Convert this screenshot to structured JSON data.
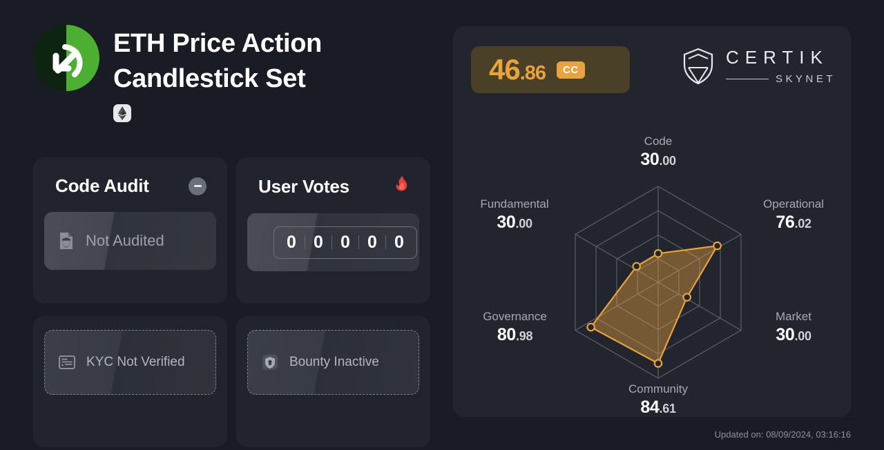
{
  "project": {
    "title": "ETH Price Action Candlestick Set",
    "logo_icon": "arrow-up-right-circle-logo",
    "chain_badges": [
      {
        "name": "ethereum-chain-badge",
        "icon": "ethereum-icon"
      }
    ]
  },
  "cards": {
    "code_audit": {
      "title": "Code Audit",
      "status_icon": "minus-badge-icon",
      "pill": {
        "label": "Not Audited",
        "icon": "document-shield-icon"
      }
    },
    "user_votes": {
      "title": "User Votes",
      "status_icon": "flame-icon",
      "counter_digits": [
        "0",
        "0",
        "0",
        "0",
        "0"
      ]
    },
    "kyc": {
      "pill": {
        "label": "KYC Not Verified",
        "icon": "id-card-icon"
      }
    },
    "bounty": {
      "pill": {
        "label": "Bounty Inactive",
        "icon": "shield-lock-icon"
      }
    }
  },
  "score": {
    "integer": "46",
    "decimal": ".86",
    "grade": "CC",
    "accent_color": "#e8a33d",
    "badge_bg": "#4a4027"
  },
  "brand": {
    "name": "CERTIK",
    "sub": "SKYNET",
    "icon": "certik-shield-icon"
  },
  "footer": {
    "updated": "Updated on: 08/09/2024, 03:16:16"
  },
  "chart_data": {
    "type": "radar",
    "title": "CertiK Skynet Security Score Breakdown",
    "categories": [
      "Code",
      "Operational",
      "Market",
      "Community",
      "Governance",
      "Fundamental"
    ],
    "values": [
      30.0,
      76.02,
      30.0,
      84.61,
      80.98,
      30.0
    ],
    "labels": [
      {
        "name": "Code",
        "int": "30",
        "dec": ".00"
      },
      {
        "name": "Operational",
        "int": "76",
        "dec": ".02"
      },
      {
        "name": "Market",
        "int": "30",
        "dec": ".00"
      },
      {
        "name": "Community",
        "int": "84",
        "dec": ".61"
      },
      {
        "name": "Governance",
        "int": "80",
        "dec": ".98"
      },
      {
        "name": "Fundamental",
        "int": "30",
        "dec": ".00"
      }
    ],
    "range": [
      0,
      100
    ],
    "rings": 4,
    "overall_score": 46.86,
    "grade": "CC",
    "series_color": "#e8a33d",
    "fill_color": "rgba(232,163,61,0.38)",
    "grid_color": "#6e717b",
    "legend": "none"
  }
}
